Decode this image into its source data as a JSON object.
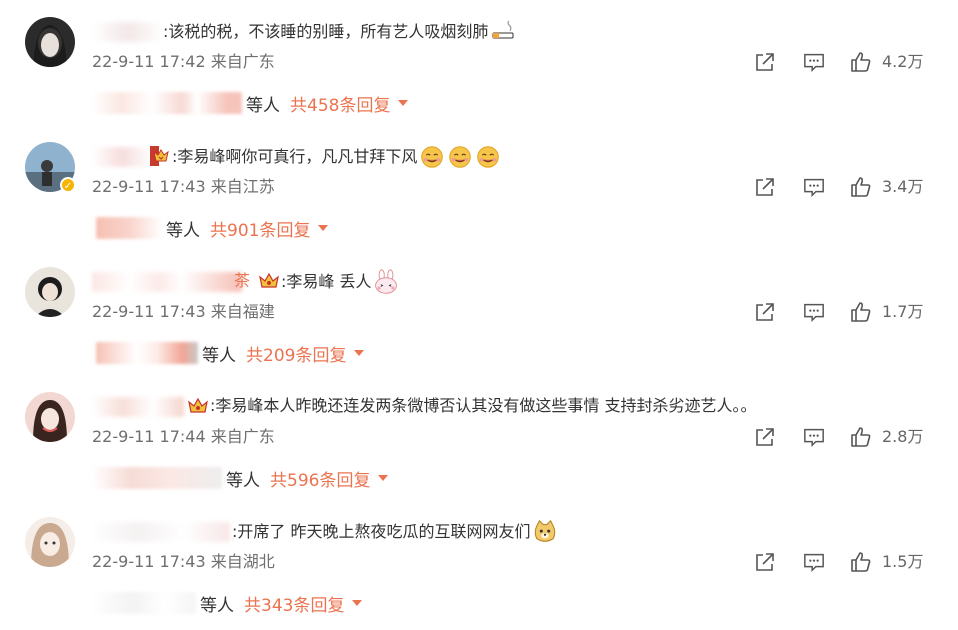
{
  "colors": {
    "accent": "#eb7350",
    "meta": "#6f6f6f",
    "text": "#333333"
  },
  "icons": {
    "share": "share-icon",
    "comment": "comment-icon",
    "like": "thumb-up-icon"
  },
  "comments": [
    {
      "text": ":该税的税，不该睡的别睡，所有艺人吸烟刻肺",
      "time": "22-9-11 17:42",
      "location": "来自广东",
      "likes": "4.2万",
      "reply_people": "等人",
      "reply_count": "共458条回复"
    },
    {
      "text": ":李易峰啊你可真行，凡凡甘拜下风",
      "time": "22-9-11 17:43",
      "location": "来自江苏",
      "likes": "3.4万",
      "reply_people": "等人",
      "reply_count": "共901条回复"
    },
    {
      "name_suffix": "茶",
      "text": ":李易峰 丢人",
      "time": "22-9-11 17:43",
      "location": "来自福建",
      "likes": "1.7万",
      "reply_people": "等人",
      "reply_count": "共209条回复"
    },
    {
      "text": ":李易峰本人昨晚还连发两条微博否认其没有做这些事情 支持封杀劣迹艺人。。",
      "time": "22-9-11 17:44",
      "location": "来自广东",
      "likes": "2.8万",
      "reply_people": "等人",
      "reply_count": "共596条回复"
    },
    {
      "text": ":开席了 昨天晚上熬夜吃瓜的互联网网友们",
      "time": "22-9-11 17:43",
      "location": "来自湖北",
      "likes": "1.5万",
      "reply_people": "等人",
      "reply_count": "共343条回复"
    }
  ]
}
